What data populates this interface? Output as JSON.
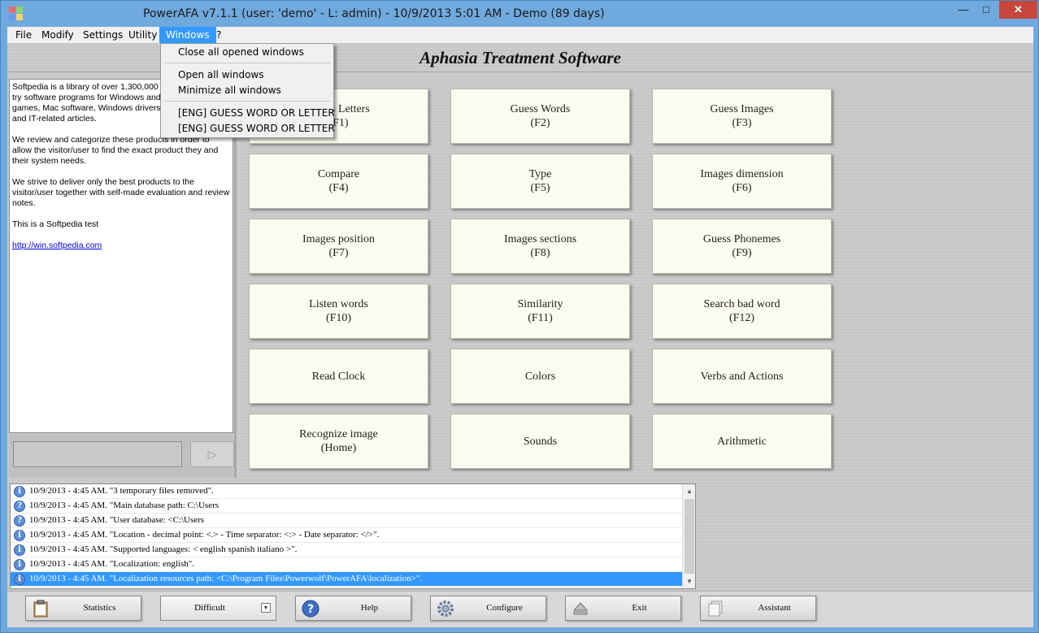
{
  "window": {
    "title": "PowerAFA v7.1.1  (user: 'demo'  - L: admin) - 10/9/2013 5:01 AM - Demo (89 days)",
    "minimize_glyph": "—",
    "maximize_glyph": "□",
    "close_glyph": "✕"
  },
  "menu": {
    "items": [
      "File",
      "Modify",
      "Settings",
      "Utility",
      "Windows",
      "?"
    ]
  },
  "windows_menu": {
    "items": [
      "Close all opened windows",
      "Open all windows",
      "Minimize all windows",
      "[ENG] GUESS WORD OR LETTER",
      "[ENG] GUESS WORD OR LETTER"
    ]
  },
  "header": {
    "title": "Aphasia Treatment Software"
  },
  "info_panel": {
    "paragraphs": [
      "Softpedia is a library of over 1,300,000 free and free-to-try software programs for Windows and Unix/Linux, games, Mac software, Windows drivers, mobile devices and IT-related articles.",
      "We review and categorize these products in order to allow the visitor/user to find the exact product they and their system needs.",
      "We strive to deliver only the best products to the visitor/user together with self-made evaluation and review notes.",
      "This is a Softpedia test"
    ],
    "link": "http://win.softpedia.com",
    "send_glyph": "▷"
  },
  "exercises": [
    {
      "name": "Guess Letters",
      "key": "(F1)"
    },
    {
      "name": "Guess Words",
      "key": "(F2)"
    },
    {
      "name": "Guess Images",
      "key": "(F3)"
    },
    {
      "name": "Compare",
      "key": "(F4)"
    },
    {
      "name": "Type",
      "key": "(F5)"
    },
    {
      "name": "Images dimension",
      "key": "(F6)"
    },
    {
      "name": "Images position",
      "key": "(F7)"
    },
    {
      "name": "Images sections",
      "key": "(F8)"
    },
    {
      "name": "Guess Phonemes",
      "key": "(F9)"
    },
    {
      "name": "Listen words",
      "key": "(F10)"
    },
    {
      "name": "Similarity",
      "key": "(F11)"
    },
    {
      "name": "Search bad word",
      "key": "(F12)"
    },
    {
      "name": "Read Clock",
      "key": ""
    },
    {
      "name": "Colors",
      "key": ""
    },
    {
      "name": "Verbs and Actions",
      "key": ""
    },
    {
      "name": "Recognize image",
      "key": "(Home)"
    },
    {
      "name": "Sounds",
      "key": ""
    },
    {
      "name": "Arithmetic",
      "key": ""
    }
  ],
  "log": {
    "entries": [
      {
        "icon": "i",
        "text": "10/9/2013 - 4:45 AM. \"3 temporary files removed\"."
      },
      {
        "icon": "?",
        "text": "10/9/2013 - 4:45 AM. \"Main database path: C:\\Users"
      },
      {
        "icon": "?",
        "text": "10/9/2013 - 4:45 AM. \"User database: <C:\\Users"
      },
      {
        "icon": "i",
        "text": "10/9/2013 - 4:45 AM. \"Location - decimal point: <.> - Time separator: <:> - Date separator: </>\"."
      },
      {
        "icon": "i",
        "text": "10/9/2013 - 4:45 AM. \"Supported languages: < english spanish italiano >\"."
      },
      {
        "icon": "i",
        "text": "10/9/2013 - 4:45 AM. \"Localization: english\"."
      },
      {
        "icon": "i",
        "text": "10/9/2013 - 4:45 AM. \"Localization resources path: <C:\\Program Files\\Powerwolf\\PowerAFA\\localization>\"."
      }
    ],
    "scroll_up": "▲",
    "scroll_down": "▼"
  },
  "toolbar": {
    "statistics": "Statistics",
    "difficulty": "Difficult",
    "difficulty_arrow": "▼",
    "help": "Help",
    "configure": "Configure",
    "exit": "Exit",
    "assistant": "Assistant"
  },
  "colors": {
    "titlebar": "#6fa9dd",
    "menu_highlight": "#3399ff",
    "exercise_button": "#fbfbef",
    "close_button": "#c7463c"
  }
}
